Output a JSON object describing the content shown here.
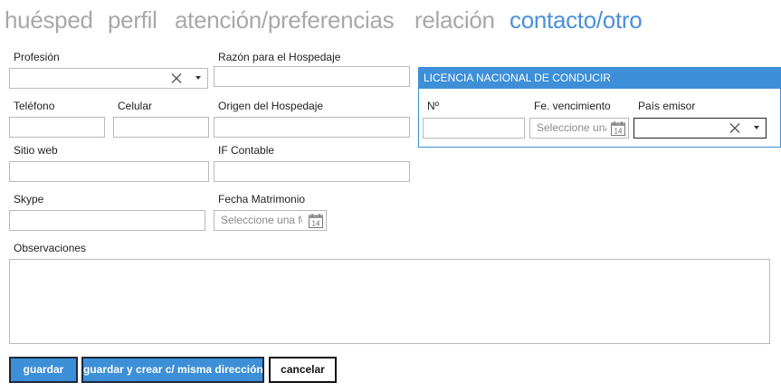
{
  "tabs": [
    {
      "label": "huésped",
      "active": false
    },
    {
      "label": "perfil",
      "active": false
    },
    {
      "label": "atención/preferencias",
      "active": false
    },
    {
      "label": "relación",
      "active": false
    },
    {
      "label": "contacto/otro",
      "active": true
    }
  ],
  "form": {
    "profesion": {
      "label": "Profesión",
      "value": ""
    },
    "razon_hospedaje": {
      "label": "Razón para el Hospedaje",
      "value": ""
    },
    "telefono": {
      "label": "Teléfono",
      "value": ""
    },
    "celular": {
      "label": "Celular",
      "value": ""
    },
    "origen_hospedaje": {
      "label": "Origen del Hospedaje",
      "value": ""
    },
    "sitio_web": {
      "label": "Sitio web",
      "value": ""
    },
    "if_contable": {
      "label": "IF Contable",
      "value": ""
    },
    "skype": {
      "label": "Skype",
      "value": ""
    },
    "fecha_matrimonio": {
      "label": "Fecha Matrimonio",
      "placeholder": "Seleccione una fe"
    },
    "observaciones": {
      "label": "Observaciones",
      "value": ""
    }
  },
  "licencia": {
    "title": "LICENCIA NACIONAL DE CONDUCIR",
    "numero": {
      "label": "Nº",
      "value": ""
    },
    "vencimiento": {
      "label": "Fe. vencimiento",
      "placeholder": "Seleccione una"
    },
    "pais_emisor": {
      "label": "País emisor",
      "value": ""
    }
  },
  "buttons": {
    "guardar": "guardar",
    "guardar_crear": "guardar y crear c/ misma dirección",
    "cancelar": "cancelar"
  },
  "colors": {
    "accent": "#3d8fd8",
    "tab_active": "#4a90d9",
    "tab_inactive": "#a8a8a8"
  },
  "icons": {
    "clear": "close-icon",
    "dropdown": "chevron-down-icon",
    "calendar": "calendar-icon",
    "calendar_day": "14"
  }
}
